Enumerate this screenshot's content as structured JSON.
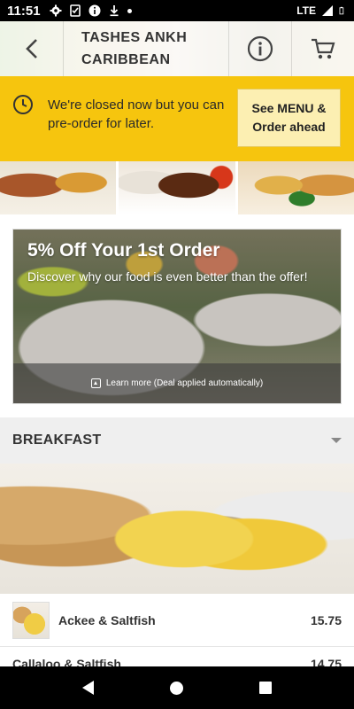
{
  "status_bar": {
    "time": "11:51",
    "network": "LTE"
  },
  "header": {
    "title": "TASHES ANKH CARIBBEAN",
    "back_icon": "back-arrow-icon",
    "info_icon": "info-circle-icon",
    "cart_icon": "cart-icon"
  },
  "closed_banner": {
    "message": "We're closed now but you can pre-order for later.",
    "button_label": "See MENU & Order ahead",
    "background_color": "#f6c50e"
  },
  "promo": {
    "title": "5% Off Your 1st Order",
    "subtitle": "Discover why our food is even better than the offer!",
    "learn_more": "Learn more (Deal applied automatically)"
  },
  "category": {
    "label": "BREAKFAST"
  },
  "menu_items": [
    {
      "name": "Ackee & Saltfish",
      "price": "15.75"
    },
    {
      "name": "Callaloo & Saltfish",
      "price": "14.75"
    }
  ]
}
